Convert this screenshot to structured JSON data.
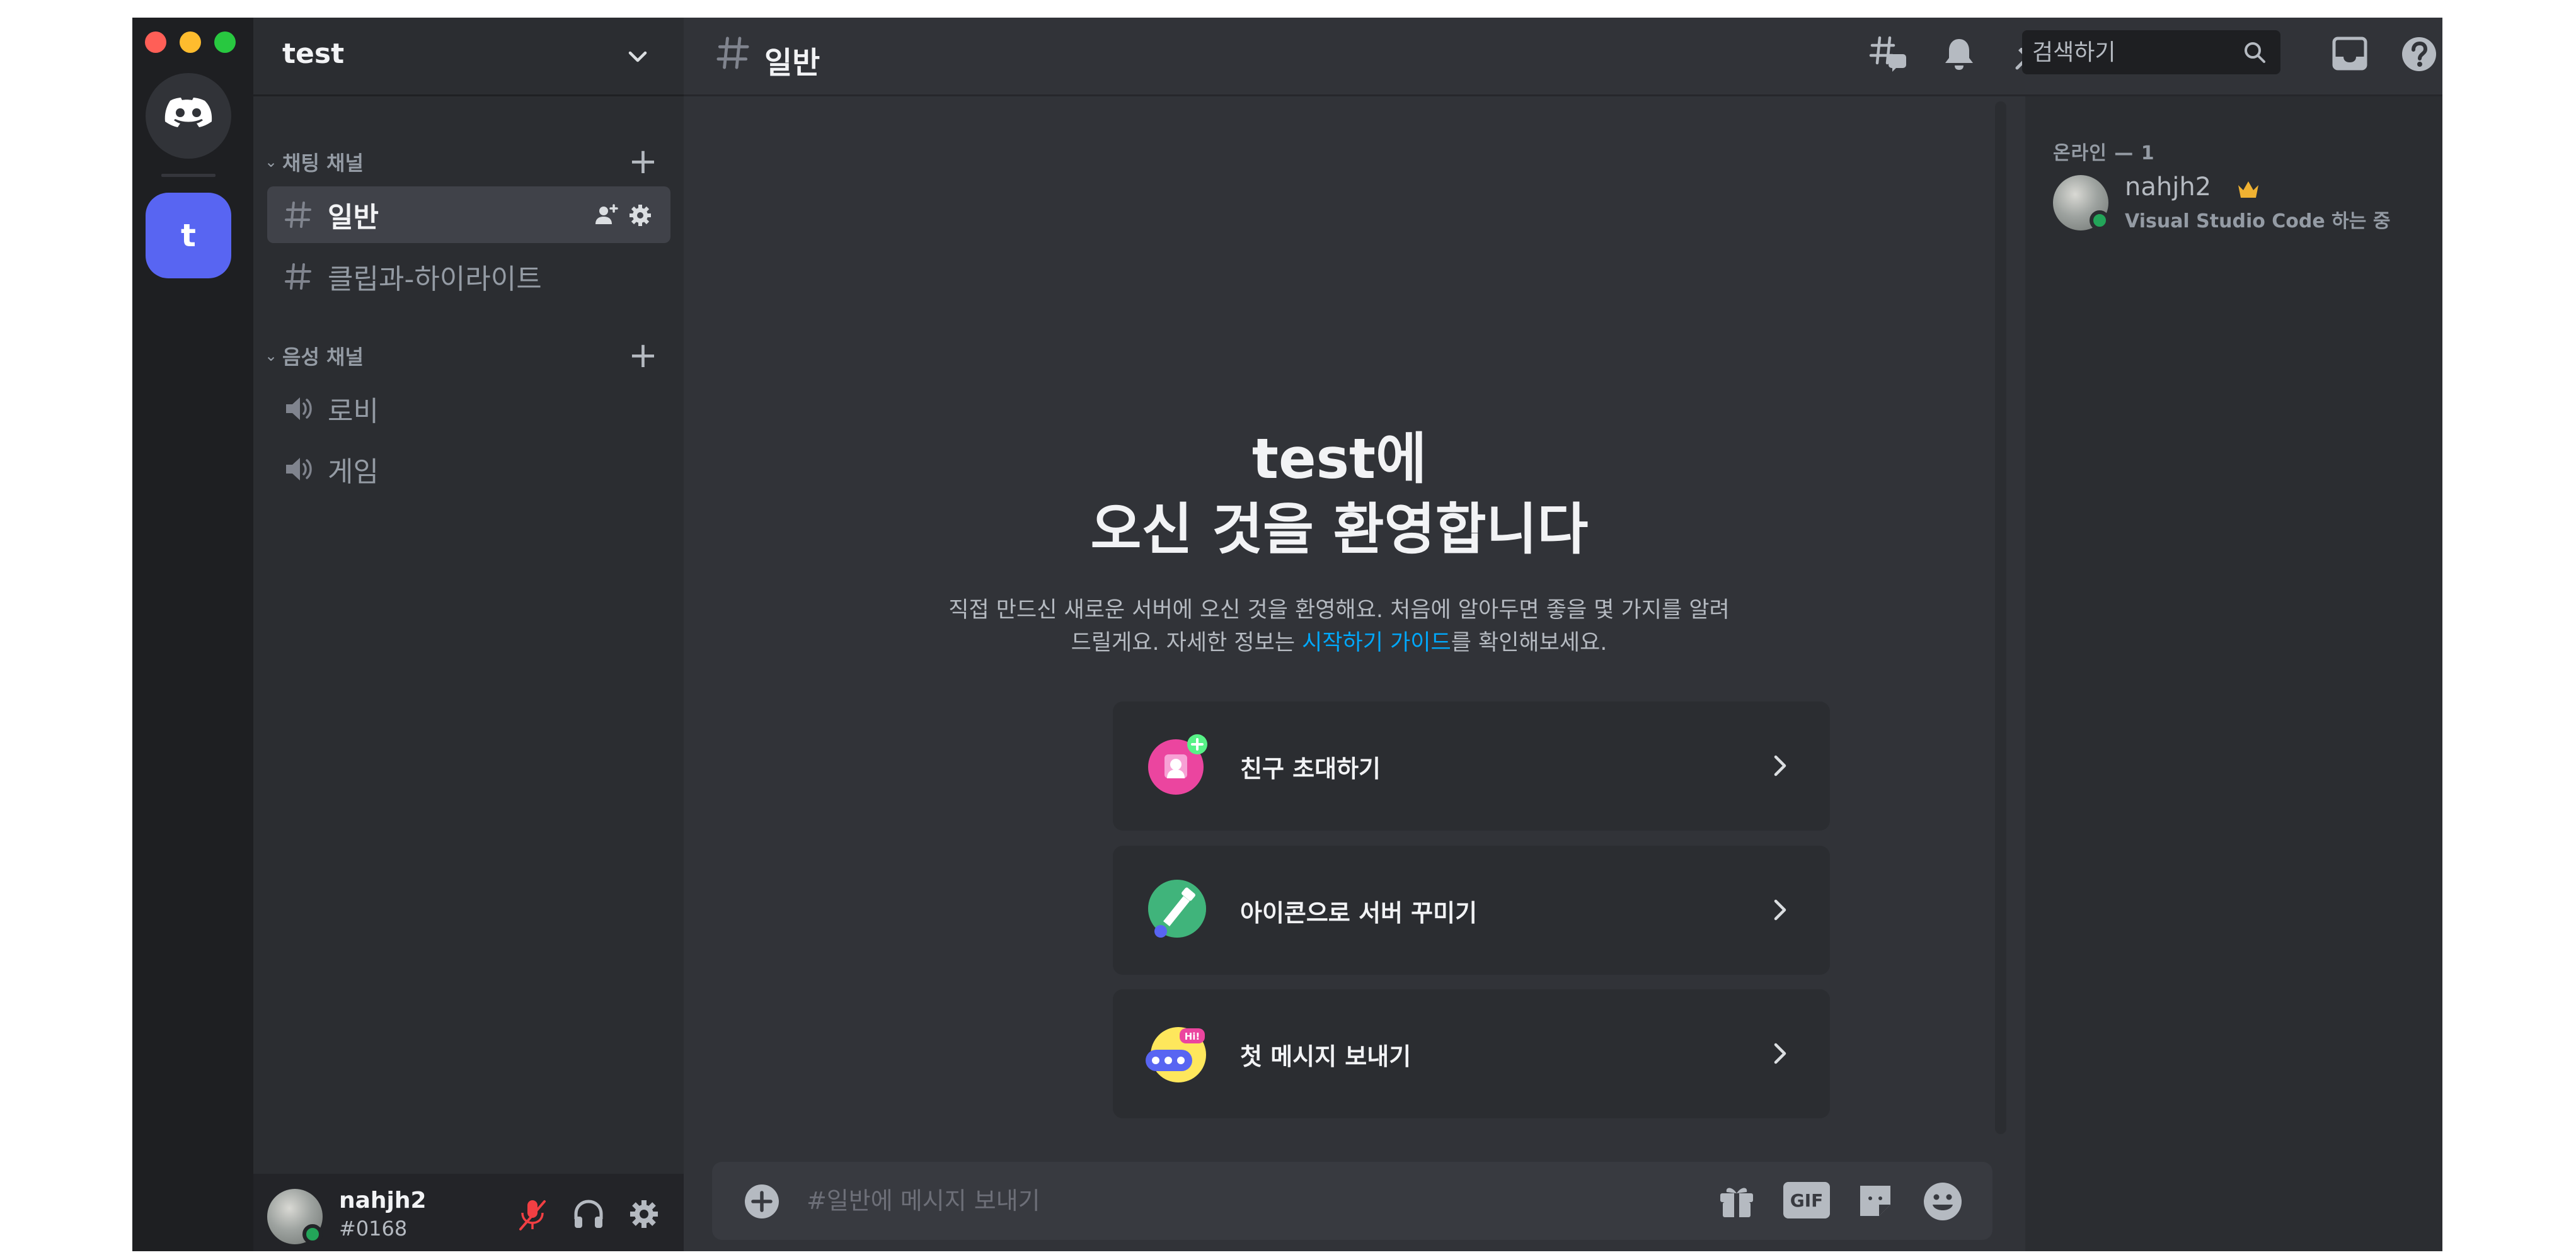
{
  "server": {
    "name": "test",
    "rail_initial": "t"
  },
  "categories": {
    "text": "채팅 채널",
    "voice": "음성 채널"
  },
  "channels": {
    "text": [
      {
        "name": "일반",
        "active": true
      },
      {
        "name": "클립과-하이라이트",
        "active": false
      }
    ],
    "voice": [
      {
        "name": "로비"
      },
      {
        "name": "게임"
      }
    ]
  },
  "header": {
    "channel_name": "일반",
    "search_placeholder": "검색하기"
  },
  "welcome": {
    "title_line1": "test에",
    "title_line2": "오신 것을 환영합니다",
    "desc_before_link": "직접 만드신 새로운 서버에 오신 것을 환영해요. 처음에 알아두면 좋을 몇 가지를 알려 드릴게요. 자세한 정보는 ",
    "desc_link": "시작하기 가이드",
    "desc_after_link": "를 확인해보세요."
  },
  "cards": [
    {
      "label": "친구 초대하기",
      "icon": "invite-friends-icon"
    },
    {
      "label": "아이콘으로 서버 꾸미기",
      "icon": "customize-server-icon"
    },
    {
      "label": "첫 메시지 보내기",
      "icon": "first-message-icon",
      "badge": "Hi!"
    }
  ],
  "composer": {
    "placeholder": "#일반에 메시지 보내기",
    "gif_label": "GIF"
  },
  "user": {
    "name": "nahjh2",
    "tag": "#0168"
  },
  "members": {
    "online_header": "온라인 — 1",
    "list": [
      {
        "name": "nahjh2",
        "activity": "Visual Studio Code 하는 중"
      }
    ]
  },
  "colors": {
    "accent": "#5865f2",
    "online": "#23a559",
    "link": "#00a8fc",
    "crown": "#f0b232"
  }
}
